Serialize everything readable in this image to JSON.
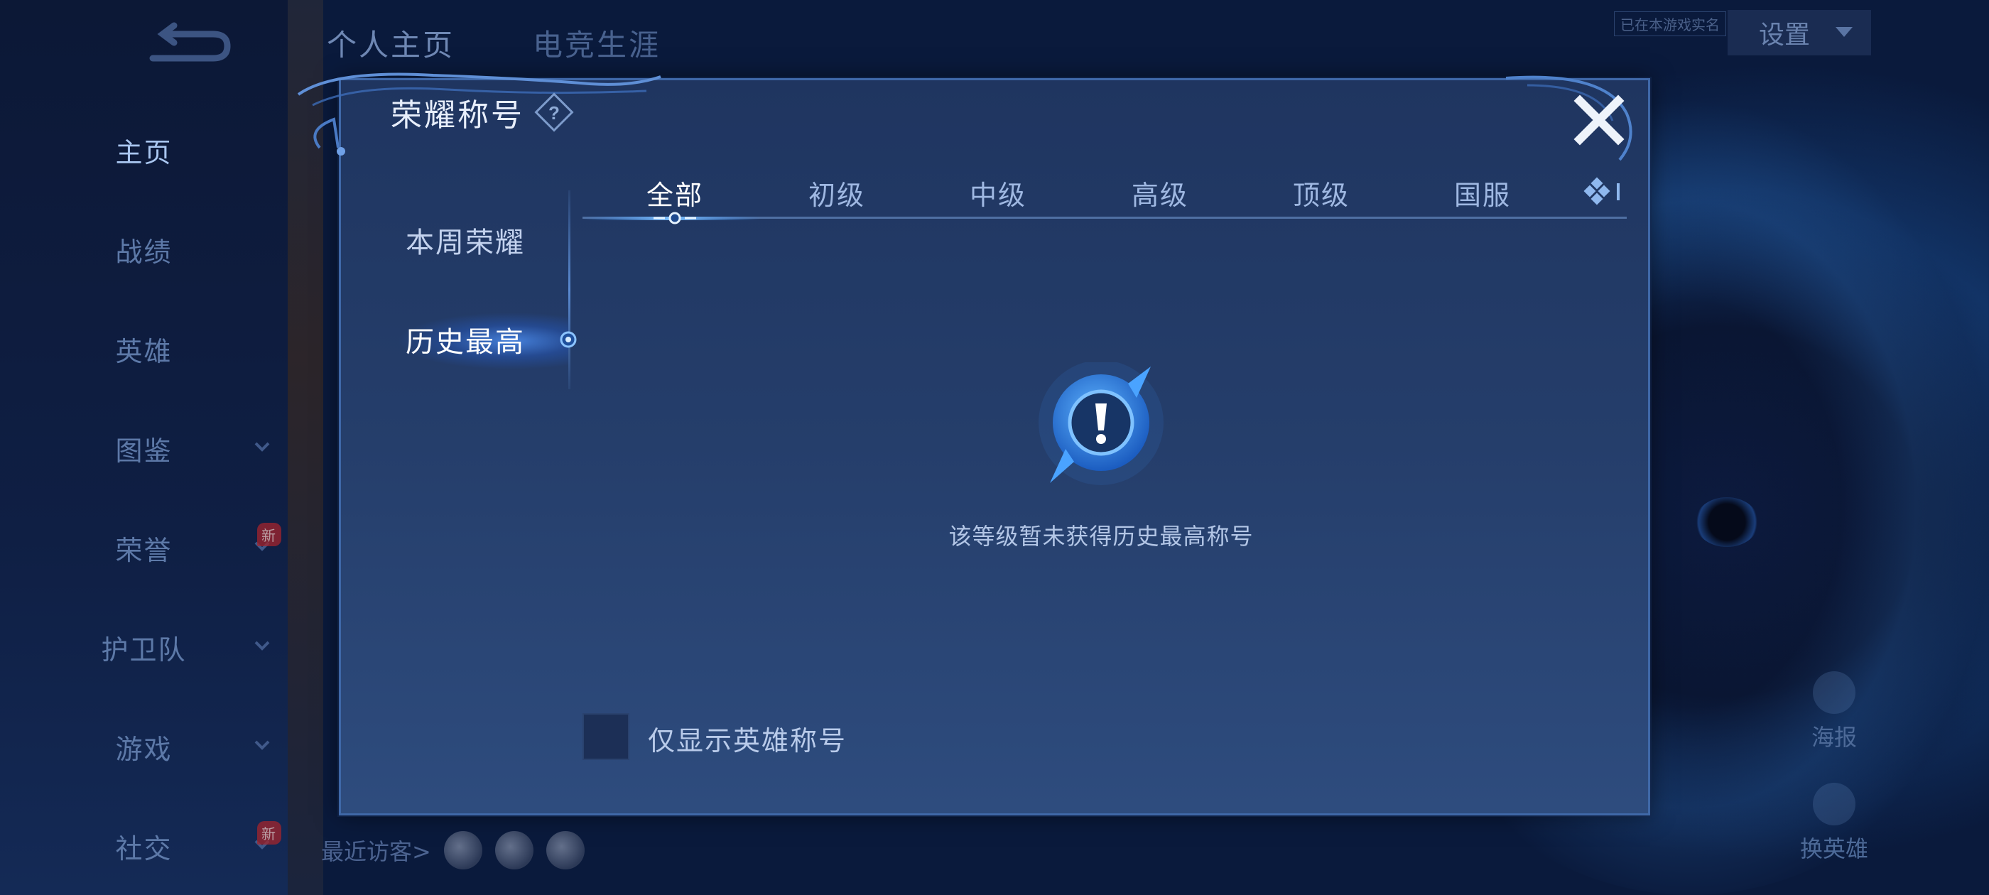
{
  "background": {
    "nav_items": [
      {
        "label": "主页",
        "active": true,
        "chevron": false,
        "badge": ""
      },
      {
        "label": "战绩",
        "active": false,
        "chevron": false,
        "badge": ""
      },
      {
        "label": "英雄",
        "active": false,
        "chevron": false,
        "badge": ""
      },
      {
        "label": "图鉴",
        "active": false,
        "chevron": true,
        "badge": ""
      },
      {
        "label": "荣誉",
        "active": false,
        "chevron": true,
        "badge": "新"
      },
      {
        "label": "护卫队",
        "active": false,
        "chevron": true,
        "badge": ""
      },
      {
        "label": "游戏",
        "active": false,
        "chevron": true,
        "badge": ""
      },
      {
        "label": "社交",
        "active": false,
        "chevron": true,
        "badge": "新"
      }
    ],
    "top_tabs": [
      "个人主页",
      "电竞生涯"
    ],
    "status_text": "已在本游戏实名",
    "settings_label": "设置",
    "poster_label": "海报",
    "change_hero_label": "换英雄",
    "recent_visitors_label": "最近访客>"
  },
  "modal": {
    "title": "荣耀称号",
    "side_menu": [
      {
        "label": "本周荣耀",
        "active": false
      },
      {
        "label": "历史最高",
        "active": true
      }
    ],
    "tabs": [
      {
        "label": "全部",
        "active": true
      },
      {
        "label": "初级",
        "active": false
      },
      {
        "label": "中级",
        "active": false
      },
      {
        "label": "高级",
        "active": false
      },
      {
        "label": "顶级",
        "active": false
      },
      {
        "label": "国服",
        "active": false
      }
    ],
    "empty_message": "该等级暂未获得历史最高称号",
    "checkbox_label": "仅显示英雄称号",
    "checkbox_checked": false
  },
  "colors": {
    "modal_border": "#3f68a8",
    "accent_blue": "#3d8df0",
    "active_text": "#ffffff"
  },
  "icons": {
    "close": "close-icon",
    "help": "help-icon",
    "empty_state": "exclamation-compass-icon",
    "more_tabs": "diamond-cluster-icon"
  }
}
